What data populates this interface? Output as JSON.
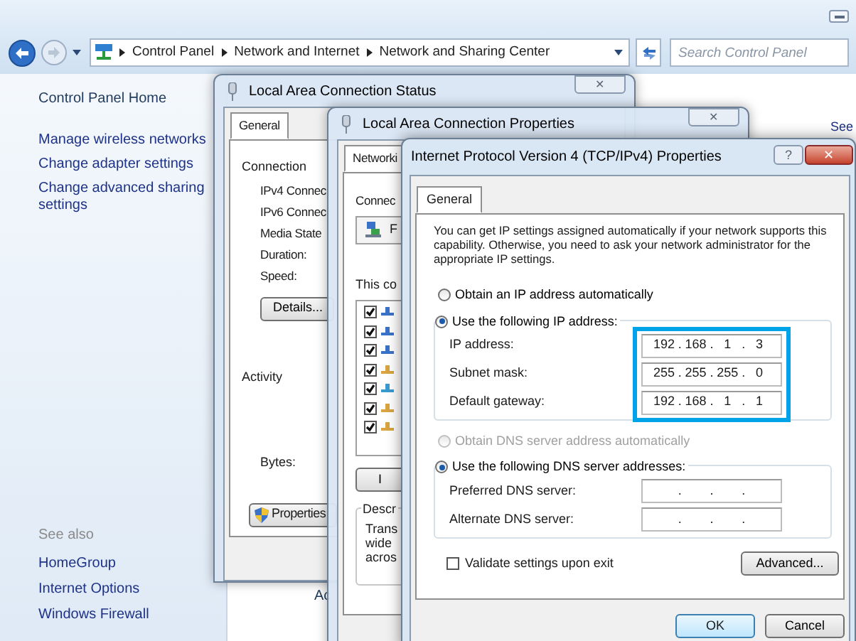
{
  "explorer": {
    "breadcrumbs": [
      "Control Panel",
      "Network and Internet",
      "Network and Sharing Center"
    ],
    "search": {
      "placeholder": "Search Control Panel"
    }
  },
  "sidebar": {
    "home": "Control Panel Home",
    "links": [
      "Manage wireless networks",
      "Change adapter settings",
      "Change advanced sharing settings"
    ],
    "see_also_heading": "See also",
    "see_also": [
      "HomeGroup",
      "Internet Options",
      "Windows Firewall"
    ]
  },
  "background": {
    "see_link": "See",
    "task_label": "Ac"
  },
  "status_window": {
    "title": "Local Area Connection Status",
    "close": "✕",
    "tabs": [
      {
        "label": "General",
        "selected": true
      }
    ],
    "connection_heading": "Connection",
    "rows": [
      "IPv4 Connec",
      "IPv6 Connec",
      "Media State",
      "Duration:",
      "Speed:"
    ],
    "details_button": "Details...",
    "activity_heading": "Activity",
    "bytes_label": "Bytes:",
    "properties_button": "Properties"
  },
  "properties_window": {
    "title": "Local Area Connection Properties",
    "close": "✕",
    "tabs": [
      {
        "label": "Networki",
        "selected": true
      }
    ],
    "connect_label": "Connec",
    "adapter": "F",
    "components_label": "This co",
    "components": [
      {
        "checked": true
      },
      {
        "checked": true
      },
      {
        "checked": true
      },
      {
        "checked": true
      },
      {
        "checked": true
      },
      {
        "checked": true
      },
      {
        "checked": true
      }
    ],
    "install_button": "I",
    "description_heading": "Descr",
    "description_lines": [
      "Trans",
      "wide",
      "acros"
    ]
  },
  "tcp_dialog": {
    "title": "Internet Protocol Version 4 (TCP/IPv4) Properties",
    "help": "?",
    "close": "✕",
    "tabs": [
      {
        "label": "General",
        "selected": true
      }
    ],
    "intro": "You can get IP settings assigned automatically if your network supports this capability. Otherwise, you need to ask your network administrator for the appropriate IP settings.",
    "octet_separator": ".",
    "ip_mode": [
      {
        "label": "Obtain an IP address automatically",
        "selected": false,
        "disabled": false
      },
      {
        "label": "Use the following IP address:",
        "selected": true,
        "disabled": false
      }
    ],
    "ip_fields": [
      {
        "label": "IP address:",
        "octets": [
          "192",
          "168",
          "1",
          "3"
        ]
      },
      {
        "label": "Subnet mask:",
        "octets": [
          "255",
          "255",
          "255",
          "0"
        ]
      },
      {
        "label": "Default gateway:",
        "octets": [
          "192",
          "168",
          "1",
          "1"
        ]
      }
    ],
    "dns_mode": [
      {
        "label": "Obtain DNS server address automatically",
        "selected": false,
        "disabled": true
      },
      {
        "label": "Use the following DNS server addresses:",
        "selected": true,
        "disabled": false
      }
    ],
    "dns_fields": [
      {
        "label": "Preferred DNS server:"
      },
      {
        "label": "Alternate DNS server:"
      }
    ],
    "validate": {
      "label": "Validate settings upon exit",
      "checked": false
    },
    "advanced_button": "Advanced...",
    "ok_button": "OK",
    "cancel_button": "Cancel"
  }
}
